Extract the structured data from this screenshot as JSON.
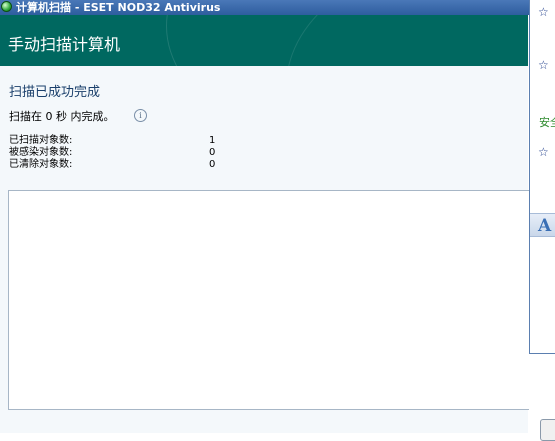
{
  "window": {
    "title": "计算机扫描 - ESET NOD32 Antivirus"
  },
  "header": {
    "title": "手动扫描计算机"
  },
  "main": {
    "status_heading": "扫描已成功完成",
    "complete_message": "扫描在 0 秒 内完成。",
    "info_icon_glyph": "i",
    "stats": [
      {
        "label": "已扫描对象数:",
        "value": "1"
      },
      {
        "label": "被感染对象数:",
        "value": "0"
      },
      {
        "label": "已清除对象数:",
        "value": "0"
      }
    ],
    "log": ""
  },
  "side_panel": {
    "star_glyph": "☆",
    "star_suffix": "`",
    "safe_text": "安全",
    "font_glyph": "A"
  }
}
